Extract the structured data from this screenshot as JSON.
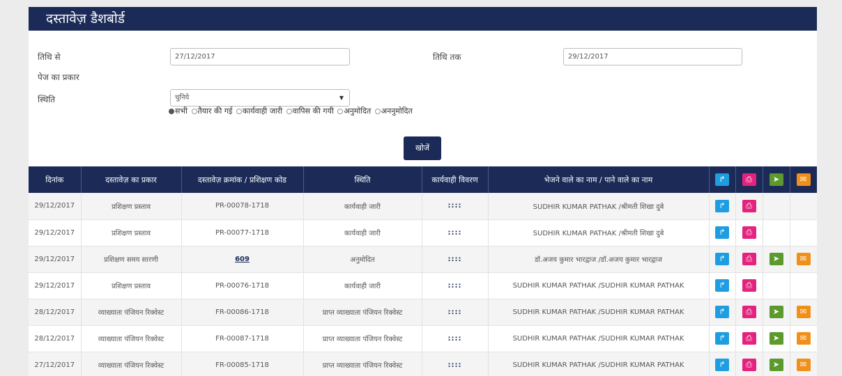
{
  "header": {
    "title": "दस्तावेज़ डैशबोर्ड"
  },
  "filters": {
    "from_label": "तिथि से",
    "from_value": "27/12/2017",
    "to_label": "तिथि तक",
    "to_value": "29/12/2017",
    "page_type_label": "पेज का प्रकार",
    "page_type_value": "चुनिये",
    "status_label": "स्थिति",
    "status_options": [
      "सभी",
      "तैयार की गई",
      "कार्यवाही जारी",
      "वापिस की गयी",
      "अनुमोदित",
      "अननुमोदित"
    ],
    "search_label": "खोजें"
  },
  "table": {
    "columns": [
      "दिनांक",
      "दस्तावेज़ का प्रकार",
      "दस्तावेज़ क्रमांक / प्रशिक्षण कोड",
      "स्थिति",
      "कार्यवाही विवरण",
      "भेजने वाले का नाम / पाने वाले का नाम"
    ],
    "header_icons": [
      "forward-icon",
      "print-icon",
      "send-icon",
      "mail-icon"
    ],
    "rows": [
      {
        "date": "29/12/2017",
        "type": "प्रशिक्षण प्रस्ताव",
        "code": "PR-00078-1718",
        "status": "कार्यवाही जारी",
        "detail": "::::",
        "names": "SUDHIR KUMAR PATHAK /श्रीमती शिखा दुबे"
      },
      {
        "date": "29/12/2017",
        "type": "प्रशिक्षण प्रस्ताव",
        "code": "PR-00077-1718",
        "status": "कार्यवाही जारी",
        "detail": "::::",
        "names": "SUDHIR KUMAR PATHAK /श्रीमती शिखा दुबे"
      },
      {
        "date": "29/12/2017",
        "type": "प्रशिक्षण समय सारणी",
        "code": "609",
        "status": "अनुमोदित",
        "detail": "::::",
        "names": "डॉ.अजय कुमार भारद्वाज /डॉ.अजय कुमार भारद्वाज"
      },
      {
        "date": "29/12/2017",
        "type": "प्रशिक्षण प्रस्ताव",
        "code": "PR-00076-1718",
        "status": "कार्यवाही जारी",
        "detail": "::::",
        "names": "SUDHIR KUMAR PATHAK /SUDHIR KUMAR PATHAK"
      },
      {
        "date": "28/12/2017",
        "type": "व्याख्याता पंजियन रिक्वेस्ट",
        "code": "FR-00086-1718",
        "status": "प्राप्त व्याख्याता पंजियन रिक्वेस्ट",
        "detail": "::::",
        "names": "SUDHIR KUMAR PATHAK /SUDHIR KUMAR PATHAK"
      },
      {
        "date": "28/12/2017",
        "type": "व्याख्याता पंजियन रिक्वेस्ट",
        "code": "FR-00087-1718",
        "status": "प्राप्त व्याख्याता पंजियन रिक्वेस्ट",
        "detail": "::::",
        "names": "SUDHIR KUMAR PATHAK /SUDHIR KUMAR PATHAK"
      },
      {
        "date": "27/12/2017",
        "type": "व्याख्याता पंजियन रिक्वेस्ट",
        "code": "FR-00085-1718",
        "status": "प्राप्त व्याख्याता पंजियन रिक्वेस्ट",
        "detail": "::::",
        "names": "SUDHIR KUMAR PATHAK /SUDHIR KUMAR PATHAK"
      }
    ]
  },
  "colors": {
    "header_bg": "#1b2a57",
    "forward": "#1e9ee0",
    "print": "#e3237e",
    "send": "#5c9a2e",
    "mail": "#f0901a"
  }
}
